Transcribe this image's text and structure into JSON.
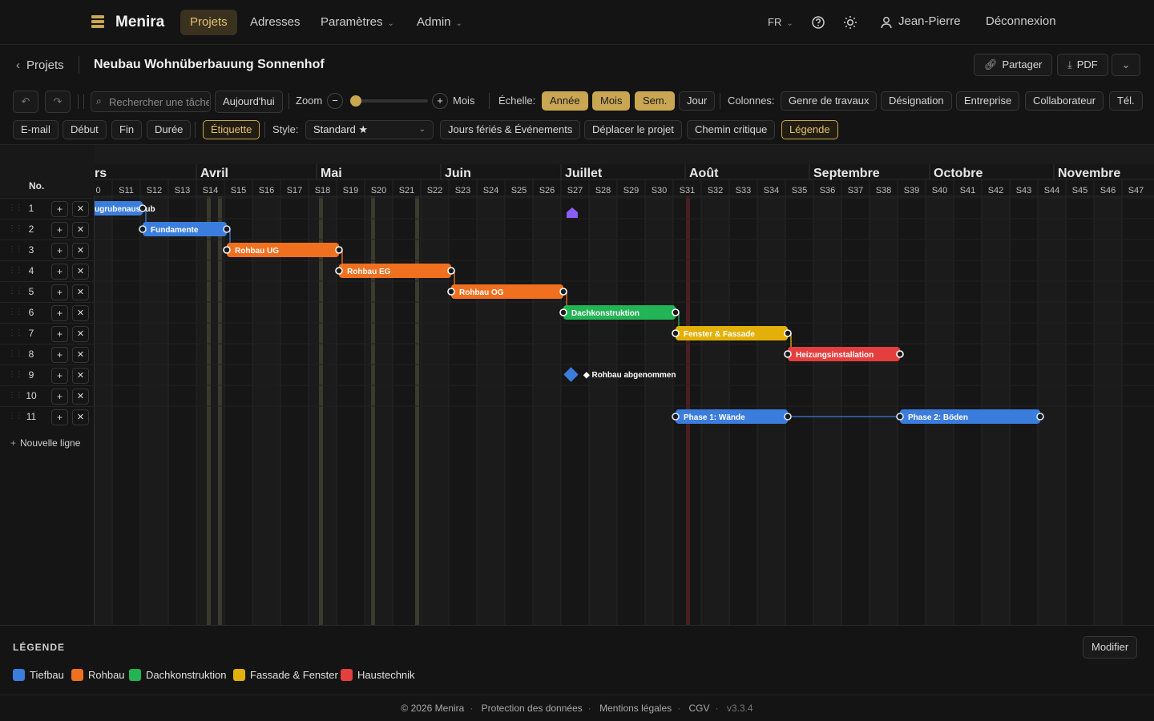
{
  "app": {
    "name": "Menira",
    "nav": [
      "Projets",
      "Adresses",
      "Paramètres",
      "Admin"
    ],
    "lang": "FR",
    "user": "Jean-Pierre",
    "logout": "Déconnexion"
  },
  "project": {
    "back": "Projets",
    "title": "Neubau Wohnüberbauung Sonnenhof",
    "share": "Partager",
    "pdf": "PDF"
  },
  "toolbar": {
    "search_placeholder": "Rechercher une tâche",
    "today": "Aujourd'hui",
    "zoom": "Zoom",
    "zoom_unit": "Mois",
    "zoom_level": 0,
    "scale_label": "Échelle:",
    "scales": [
      "Année",
      "Mois",
      "Sem.",
      "Jour"
    ],
    "active_scales": [
      "Année",
      "Mois",
      "Sem."
    ],
    "columns_label": "Colonnes:",
    "columns": [
      "Genre de travaux",
      "Désignation",
      "Entreprise",
      "Collaborateur",
      "Tél."
    ],
    "row2": [
      "E-mail",
      "Début",
      "Fin",
      "Durée",
      "Étiquette"
    ],
    "style_label": "Style:",
    "style_value": "Standard ★",
    "actions": [
      "Jours fériés & Événements",
      "Déplacer le projet",
      "Chemin critique",
      "Légende"
    ]
  },
  "gantt": {
    "col_header": "No.",
    "months": [
      {
        "label": "rs"
      },
      {
        "label": "Avril"
      },
      {
        "label": "Mai"
      },
      {
        "label": "Juin"
      },
      {
        "label": "Juillet"
      },
      {
        "label": "Août"
      },
      {
        "label": "Septembre"
      },
      {
        "label": "Octobre"
      },
      {
        "label": "Novembre"
      }
    ],
    "weeks": [
      "0",
      "S11",
      "S12",
      "S13",
      "S14",
      "S15",
      "S16",
      "S17",
      "S18",
      "S19",
      "S20",
      "S21",
      "S22",
      "S23",
      "S24",
      "S25",
      "S26",
      "S27",
      "S28",
      "S29",
      "S30",
      "S31",
      "S32",
      "S33",
      "S34",
      "S35",
      "S36",
      "S37",
      "S38",
      "S39",
      "S40",
      "S41",
      "S42",
      "S43",
      "S44",
      "S45",
      "S46",
      "S47"
    ],
    "rows": [
      1,
      2,
      3,
      4,
      5,
      6,
      7,
      8,
      9,
      10,
      11
    ],
    "tasks": [
      {
        "row": 1,
        "label": "ugrubenaushub",
        "color": "#3b7ddd",
        "start_week": "S10",
        "end_week": "S12"
      },
      {
        "row": 2,
        "label": "Fundamente",
        "color": "#3b7ddd",
        "start_week": "S12",
        "end_week": "S15"
      },
      {
        "row": 3,
        "label": "Rohbau UG",
        "color": "#f07020",
        "start_week": "S15",
        "end_week": "S19"
      },
      {
        "row": 4,
        "label": "Rohbau EG",
        "color": "#f07020",
        "start_week": "S19",
        "end_week": "S23"
      },
      {
        "row": 5,
        "label": "Rohbau OG",
        "color": "#f07020",
        "start_week": "S23",
        "end_week": "S27"
      },
      {
        "row": 6,
        "label": "Dachkonstruktion",
        "color": "#22b455",
        "start_week": "S27",
        "end_week": "S31"
      },
      {
        "row": 7,
        "label": "Fenster & Fassade",
        "color": "#e2b008",
        "start_week": "S31",
        "end_week": "S35"
      },
      {
        "row": 8,
        "label": "Heizungsinstallation",
        "color": "#e53e3e",
        "start_week": "S35",
        "end_week": "S39"
      },
      {
        "row": 11,
        "label": "Phase 1: Wände",
        "color": "#3b7ddd",
        "start_week": "S31",
        "end_week": "S35"
      },
      {
        "row": 11,
        "label": "Phase 2: Böden",
        "color": "#3b7ddd",
        "start_week": "S39",
        "end_week": "S44"
      }
    ],
    "milestone": {
      "row": 9,
      "label": "◆ Rohbau abgenommen",
      "color": "#3b7ddd"
    },
    "new_row": "Nouvelle ligne"
  },
  "legend": {
    "title": "LÉGENDE",
    "edit": "Modifier",
    "items": [
      {
        "label": "Tiefbau",
        "color": "#3b7ddd"
      },
      {
        "label": "Rohbau",
        "color": "#f07020"
      },
      {
        "label": "Dachkonstruktion",
        "color": "#22b455"
      },
      {
        "label": "Fassade & Fenster",
        "color": "#e2b008"
      },
      {
        "label": "Haustechnik",
        "color": "#e53e3e"
      }
    ]
  },
  "footer": {
    "copyright": "© 2026 Menira",
    "links": [
      "Protection des données",
      "Mentions légales",
      "CGV"
    ],
    "version": "v3.3.4"
  }
}
